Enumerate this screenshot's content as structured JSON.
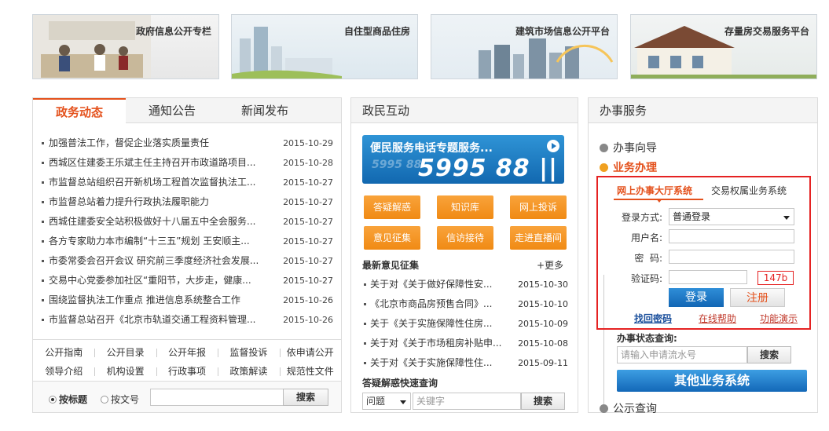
{
  "banners": [
    {
      "title": "政府信息公开专栏"
    },
    {
      "title": "自住型商品住房"
    },
    {
      "title": "建筑市场信息公开平台"
    },
    {
      "title": "存量房交易服务平台"
    }
  ],
  "left": {
    "tabs": [
      "政务动态",
      "通知公告",
      "新闻发布"
    ],
    "news": [
      {
        "title": "加强普法工作，督促企业落实质量责任",
        "date": "2015-10-29"
      },
      {
        "title": "西城区住建委王乐斌主任主持召开市政道路项目...",
        "date": "2015-10-28"
      },
      {
        "title": "市监督总站组织召开新机场工程首次监督执法工...",
        "date": "2015-10-27"
      },
      {
        "title": "市监督总站着力提升行政执法履职能力",
        "date": "2015-10-27"
      },
      {
        "title": "西城住建委安全站积极做好十八届五中全会服务...",
        "date": "2015-10-27"
      },
      {
        "title": "各方专家助力本市编制“十三五”规划 王安顺主...",
        "date": "2015-10-27"
      },
      {
        "title": "市委常委会召开会议 研究前三季度经济社会发展...",
        "date": "2015-10-27"
      },
      {
        "title": "交易中心党委参加社区“重阳节，大步走，健康...",
        "date": "2015-10-27"
      },
      {
        "title": "围绕监督执法工作重点 推进信息系统整合工作",
        "date": "2015-10-26"
      },
      {
        "title": "市监督总站召开《北京市轨道交通工程资料管理...",
        "date": "2015-10-26"
      }
    ],
    "links_row1": [
      "公开指南",
      "公开目录",
      "公开年报",
      "监督投诉",
      "依申请公开"
    ],
    "links_row2": [
      "领导介绍",
      "机构设置",
      "行政事项",
      "政策解读",
      "规范性文件"
    ],
    "search": {
      "radio1": "按标题",
      "radio2": "按文号",
      "button": "搜索"
    }
  },
  "middle": {
    "header": "政民互动",
    "hotline": {
      "text": "便民服务电话专题服务...",
      "faded": "5995 88",
      "number": "5995 88 ||"
    },
    "buttons": [
      "答疑解惑",
      "知识库",
      "网上投诉",
      "意见征集",
      "信访接待",
      "走进直播间"
    ],
    "latest_title": "最新意见征集",
    "more": "+更多",
    "opinions": [
      {
        "title": "关于对《关于做好保障性安...",
        "date": "2015-10-30"
      },
      {
        "title": "《北京市商品房预售合同》...",
        "date": "2015-10-10"
      },
      {
        "title": "关于《关于实施保障性住房...",
        "date": "2015-10-09"
      },
      {
        "title": "关于对《关于市场租房补贴申...",
        "date": "2015-10-08"
      },
      {
        "title": "关于对《关于实施保障性住...",
        "date": "2015-09-11"
      }
    ],
    "query_title": "答疑解惑快速查询",
    "query_select": "问题",
    "query_placeholder": "关键字",
    "query_button": "搜索"
  },
  "right": {
    "header": "办事服务",
    "nav1": "办事向导",
    "nav2": "业务办理",
    "tab1": "网上办事大厅系统",
    "tab2": "交易权属业务系统",
    "login_mode_label": "登录方式:",
    "login_mode_value": "普通登录",
    "username_label": "用户名:",
    "password_label": "密  码:",
    "captcha_label": "验证码:",
    "captcha_value": "147b",
    "login_button": "登录",
    "register_button": "注册",
    "link1": "找回密码",
    "link2": "在线帮助",
    "link3": "功能演示",
    "status_title": "办事状态查询:",
    "status_placeholder": "请输入申请流水号",
    "status_button": "搜索",
    "other_button": "其他业务系统",
    "nav3": "公示查询",
    "colors": {
      "accent": "#e4511c",
      "highlight_box": "#e52222",
      "blue": "#1268b0"
    }
  }
}
